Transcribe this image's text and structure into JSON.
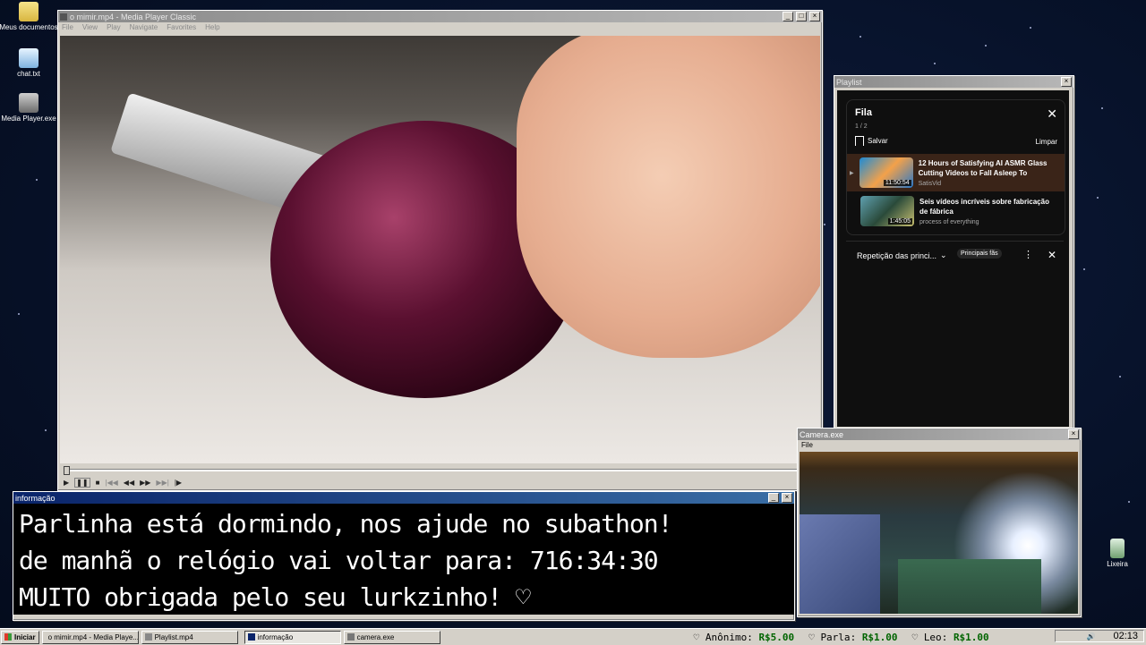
{
  "desktop": {
    "icons": [
      {
        "label": "Meus documentos",
        "icon": "folder-icon"
      },
      {
        "label": "chat.txt",
        "icon": "notepad-icon"
      },
      {
        "label": "Media Player.exe",
        "icon": "media-player-icon"
      },
      {
        "label": "Lixeira",
        "icon": "recycle-bin-icon"
      }
    ]
  },
  "player": {
    "title": "o mimir.mp4 - Media Player Classic",
    "menu": [
      "File",
      "View",
      "Play",
      "Navigate",
      "Favorites",
      "Help"
    ]
  },
  "playlist": {
    "window_title": "Playlist",
    "heading": "Fila",
    "count": "1 / 2",
    "save_label": "Salvar",
    "clear_label": "Limpar",
    "items": [
      {
        "title": "12 Hours of Satisfying AI ASMR Glass Cutting Videos to Fall Asleep To",
        "channel": "SatisVid",
        "duration": "11:50:54"
      },
      {
        "title": "Seis vídeos incríveis sobre fabricação de fábrica",
        "channel": "process of everything",
        "duration": "1:45:05"
      }
    ],
    "chat_selector": "Repetição das princi...",
    "chat_badge": "Principais fãs"
  },
  "info": {
    "title": "informação",
    "line1": "Parlinha está dormindo, nos ajude no subathon!",
    "line2": "de manhã o relógio vai voltar para:  716:34:30",
    "line3": "MUITO obrigada pelo seu lurkzinho! ♡"
  },
  "camera": {
    "title": "Camera.exe",
    "menu": "File"
  },
  "taskbar": {
    "start": "Iniciar",
    "buttons": [
      "o mimir.mp4 - Media Playe...",
      "Playlist.mp4",
      "informação",
      "camera.exe"
    ],
    "ticker": [
      {
        "name": "Anônimo",
        "amount": "R$5.00"
      },
      {
        "name": "Parla",
        "amount": "R$1.00"
      },
      {
        "name": "Leo",
        "amount": "R$1.00"
      }
    ],
    "clock": "02:13"
  },
  "colors": {
    "accent": "#0a246a",
    "donation": "#006400",
    "yt_bg": "#0f0f0f"
  }
}
